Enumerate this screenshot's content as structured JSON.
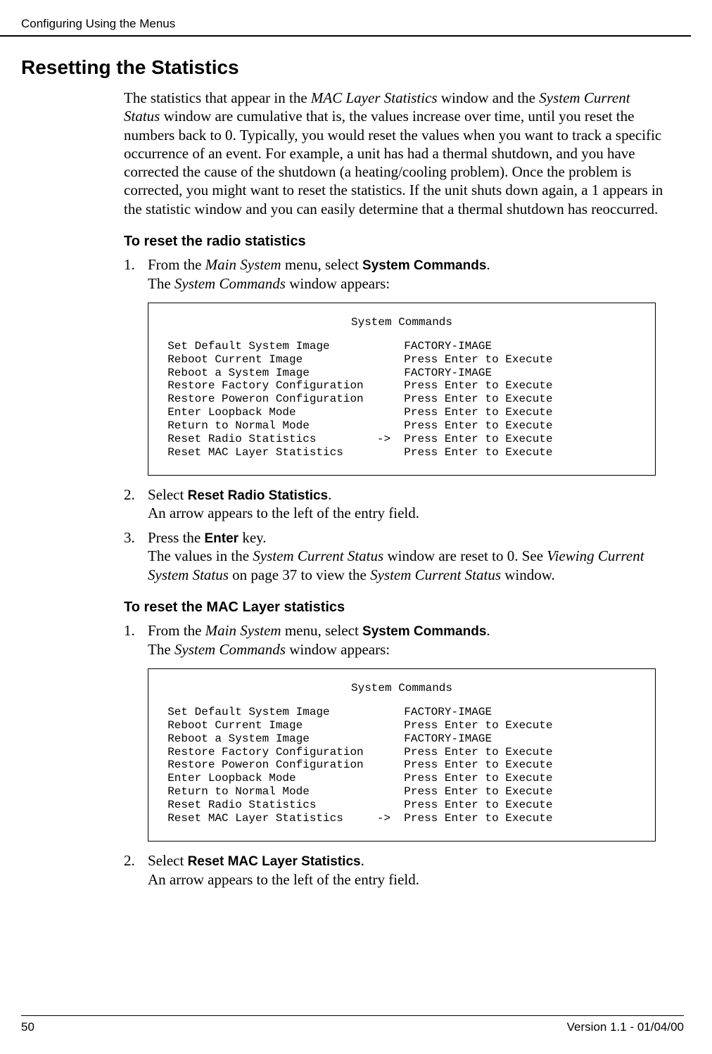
{
  "header": {
    "running": "Configuring Using the Menus"
  },
  "h1": "Resetting the Statistics",
  "intro": "The statistics that appear in the MAC Layer Statistics window and the System Current Status window are cumulative that is, the values increase over time, until you reset the numbers back to 0. Typically, you would reset the values when you want to track a specific occurrence of an event. For example, a unit has had a thermal shutdown, and you have corrected the cause of the shutdown (a heating/cooling problem). Once the problem is corrected, you might want to reset the statistics. If the unit shuts down again, a 1 appears in the statistic window and you can easily determine that a thermal shutdown has reoccurred.",
  "sec1": {
    "title": "To reset the radio statistics",
    "step1_num": "1.",
    "step1_prefix": "From the ",
    "step1_menu": "Main System",
    "step1_mid": " menu, select ",
    "step1_cmd": "System Commands",
    "step1_suffix": ".",
    "step1_line2_prefix": "The ",
    "step1_line2_win": "System Commands",
    "step1_line2_suffix": " window appears:",
    "term_title": "System Commands",
    "term_body": "  Set Default System Image           FACTORY-IMAGE\n  Reboot Current Image               Press Enter to Execute\n  Reboot a System Image              FACTORY-IMAGE\n  Restore Factory Configuration      Press Enter to Execute\n  Restore Poweron Configuration      Press Enter to Execute\n  Enter Loopback Mode                Press Enter to Execute\n  Return to Normal Mode              Press Enter to Execute\n  Reset Radio Statistics         ->  Press Enter to Execute\n  Reset MAC Layer Statistics         Press Enter to Execute",
    "step2_num": "2.",
    "step2_prefix": "Select ",
    "step2_cmd": "Reset Radio Statistics",
    "step2_suffix": ".",
    "step2_line2": "An arrow appears to the left of the entry field.",
    "step3_num": "3.",
    "step3_prefix": "Press the ",
    "step3_cmd": "Enter",
    "step3_suffix": " key.",
    "step3_line2_p1": "The values in the ",
    "step3_line2_i1": "System Current Status",
    "step3_line2_p2": " window are reset to 0. See ",
    "step3_line2_i2": "Viewing Current System Status",
    "step3_line2_p3": " on page 37 to view the ",
    "step3_line2_i3": "System Current Status",
    "step3_line2_p4": " window."
  },
  "sec2": {
    "title": "To reset the MAC Layer statistics",
    "step1_num": "1.",
    "step1_prefix": "From the ",
    "step1_menu": "Main System",
    "step1_mid": " menu, select ",
    "step1_cmd": "System Commands",
    "step1_suffix": ".",
    "step1_line2_prefix": "The ",
    "step1_line2_win": "System Commands",
    "step1_line2_suffix": " window appears:",
    "term_title": "System Commands",
    "term_body": "  Set Default System Image           FACTORY-IMAGE\n  Reboot Current Image               Press Enter to Execute\n  Reboot a System Image              FACTORY-IMAGE\n  Restore Factory Configuration      Press Enter to Execute\n  Restore Poweron Configuration      Press Enter to Execute\n  Enter Loopback Mode                Press Enter to Execute\n  Return to Normal Mode              Press Enter to Execute\n  Reset Radio Statistics             Press Enter to Execute\n  Reset MAC Layer Statistics     ->  Press Enter to Execute",
    "step2_num": "2.",
    "step2_prefix": "Select ",
    "step2_cmd": "Reset MAC Layer Statistics",
    "step2_suffix": ".",
    "step2_line2": "An arrow appears to the left of the entry field."
  },
  "footer": {
    "page": "50",
    "version": "Version 1.1 - 01/04/00"
  }
}
